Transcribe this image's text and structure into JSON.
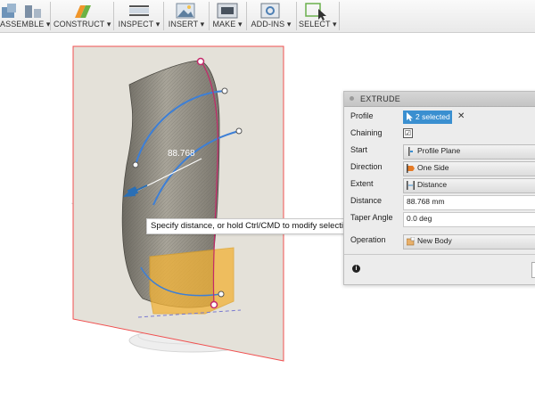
{
  "toolbar": {
    "assemble": "ASSEMBLE ▾",
    "construct": "CONSTRUCT ▾",
    "inspect": "INSPECT ▾",
    "insert": "INSERT ▾",
    "make": "MAKE ▾",
    "addins": "ADD-INS ▾",
    "select": "SELECT ▾"
  },
  "viewport": {
    "dimension_label": "88.768",
    "tooltip": "Specify distance, or hold Ctrl/CMD to modify selections"
  },
  "extrude": {
    "title": "EXTRUDE",
    "profile_label": "Profile",
    "profile_value": "2 selected",
    "clear_symbol": "✕",
    "chaining_label": "Chaining",
    "chaining_checked": "☑",
    "start_label": "Start",
    "start_value": "Profile Plane",
    "direction_label": "Direction",
    "direction_value": "One Side",
    "extent_label": "Extent",
    "extent_value": "Distance",
    "distance_label": "Distance",
    "distance_value": "88.768 mm",
    "taper_label": "Taper Angle",
    "taper_value": "0.0 deg",
    "operation_label": "Operation",
    "operation_value": "New Body",
    "info_symbol": "i"
  },
  "colors": {
    "accent": "#3a8fd0",
    "sketch_plane": "#e4e1d9",
    "plane_edge": "#f05050",
    "body": "#8d8a80",
    "sketch_curve": "#3d7fd6",
    "profile_highlight": "#f2b235",
    "point_marker": "#c4296a"
  },
  "icons": [
    "assemble-icon",
    "construct-icon",
    "inspect-icon",
    "insert-icon",
    "make-icon",
    "addins-icon",
    "select-icon",
    "distance-arrow-icon"
  ]
}
